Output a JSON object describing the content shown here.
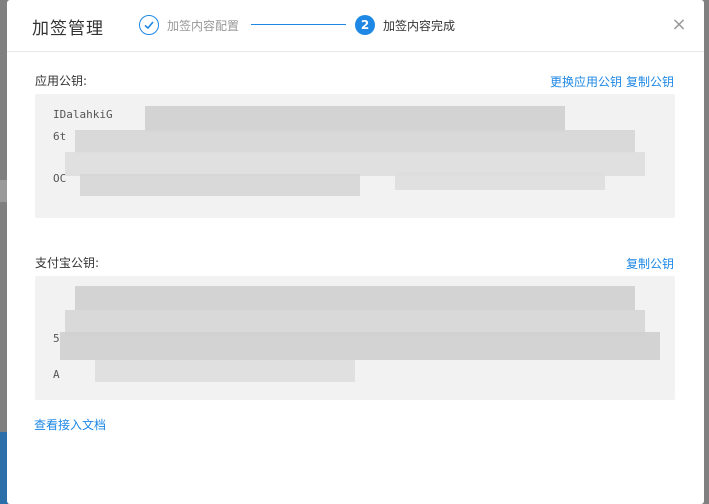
{
  "modal": {
    "title": "加签管理",
    "close_icon": "×",
    "steps": [
      {
        "label": "加签内容配置",
        "status": "done",
        "icon": "✓"
      },
      {
        "label": "加签内容完成",
        "status": "active",
        "number": "2"
      }
    ]
  },
  "app_key": {
    "label": "应用公钥:",
    "actions": [
      "更换应用公钥",
      "复制公钥"
    ],
    "lines": [
      "IDalahkiG",
      "6t",
      "",
      "OC"
    ]
  },
  "alipay_key": {
    "label": "支付宝公钥:",
    "actions": [
      "复制公钥"
    ],
    "lines": [
      "",
      "",
      "5",
      "A"
    ]
  },
  "doc_link": "查看接入文档",
  "colors": {
    "accent": "#1e88e5",
    "box_bg": "#f2f2f2",
    "title": "#333333"
  }
}
